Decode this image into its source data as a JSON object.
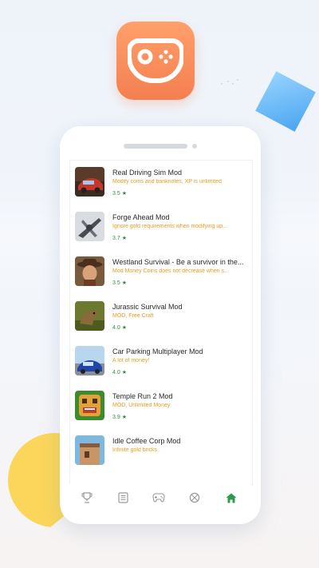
{
  "screen": {
    "items": [
      {
        "title": "Real Driving Sim Mod",
        "desc": "Modify coins and banknotes, XP is unlimited",
        "rating": "3.5",
        "thumb": "car"
      },
      {
        "title": "Forge Ahead Mod",
        "desc": "Ignore gold requirements when modifying up...",
        "rating": "3.7",
        "thumb": "plane"
      },
      {
        "title": "Westland Survival - Be a survivor in the...",
        "desc": "Mod Money Coins does not decrease when s...",
        "rating": "3.5",
        "thumb": "cowboy"
      },
      {
        "title": "Jurassic Survival Mod",
        "desc": "MOD, Free Craft",
        "rating": "4.0",
        "thumb": "dino"
      },
      {
        "title": "Car Parking Multiplayer Mod",
        "desc": "A lot of money!",
        "rating": "4.0",
        "thumb": "parking"
      },
      {
        "title": "Temple Run 2 Mod",
        "desc": "MOD, Unlimited Money",
        "rating": "3.9",
        "thumb": "temple"
      },
      {
        "title": "Idle Coffee Corp Mod",
        "desc": "Infinite gold bricks",
        "rating": "",
        "thumb": "coffee"
      }
    ]
  },
  "nav": {
    "items": [
      {
        "icon": "trophy-icon"
      },
      {
        "icon": "list-icon"
      },
      {
        "icon": "gamepad-icon"
      },
      {
        "icon": "crossed-circle-icon"
      },
      {
        "icon": "home-icon",
        "active": true
      }
    ],
    "active_color": "#2e9b4a",
    "inactive_color": "#9a9a9a"
  },
  "colors": {
    "accent_orange": "#f47f50",
    "desc_orange": "#f09a1a",
    "rating_green": "#2e8f40",
    "cube_blue": "#3d9ff0",
    "blob_yellow": "#fbd65a"
  }
}
